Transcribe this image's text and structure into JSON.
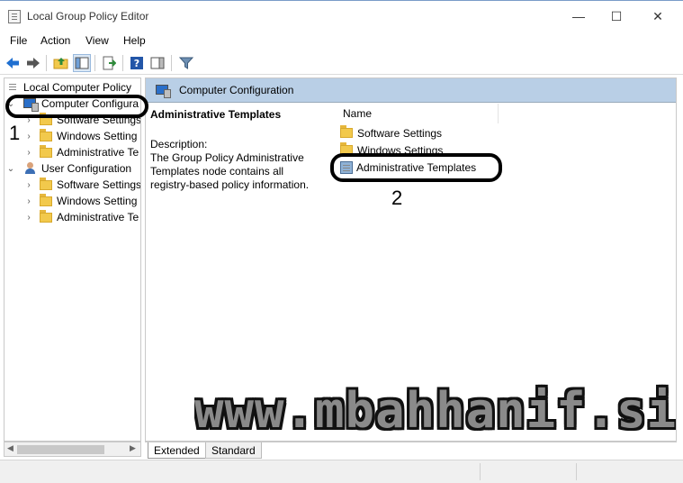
{
  "window": {
    "title": "Local Group Policy Editor",
    "minimize_glyph": "—",
    "maximize_glyph": "☐",
    "close_glyph": "✕"
  },
  "menu": [
    "File",
    "Action",
    "View",
    "Help"
  ],
  "toolbar": {
    "icons": [
      "back-arrow-icon",
      "forward-arrow-icon",
      "up-folder-icon",
      "show-hide-tree-icon",
      "export-list-icon",
      "help-icon",
      "show-hide-action-pane-icon",
      "filter-icon"
    ]
  },
  "tree": {
    "root": "Local Computer Policy",
    "computer_config": "Computer Configura",
    "computer_children": [
      "Software Settings",
      "Windows Setting",
      "Administrative Te"
    ],
    "user_config": "User Configuration",
    "user_children": [
      "Software Settings",
      "Windows Setting",
      "Administrative Te"
    ]
  },
  "right": {
    "header": "Computer Configuration",
    "desc_title": "Administrative Templates",
    "desc_label": "Description:",
    "desc_text": "The Group Policy Administrative Templates node contains all registry-based policy information.",
    "column_name": "Name",
    "items": [
      "Software Settings",
      "Windows Settings",
      "Administrative Templates"
    ]
  },
  "tabs": [
    "Extended",
    "Standard"
  ],
  "annotations": [
    "1",
    "2"
  ],
  "watermark": "www.mbahhanif.site",
  "colors": {
    "header_bg": "#b9cfe6",
    "folder": "#f2c94c",
    "accent_blue": "#2a6fc9"
  }
}
